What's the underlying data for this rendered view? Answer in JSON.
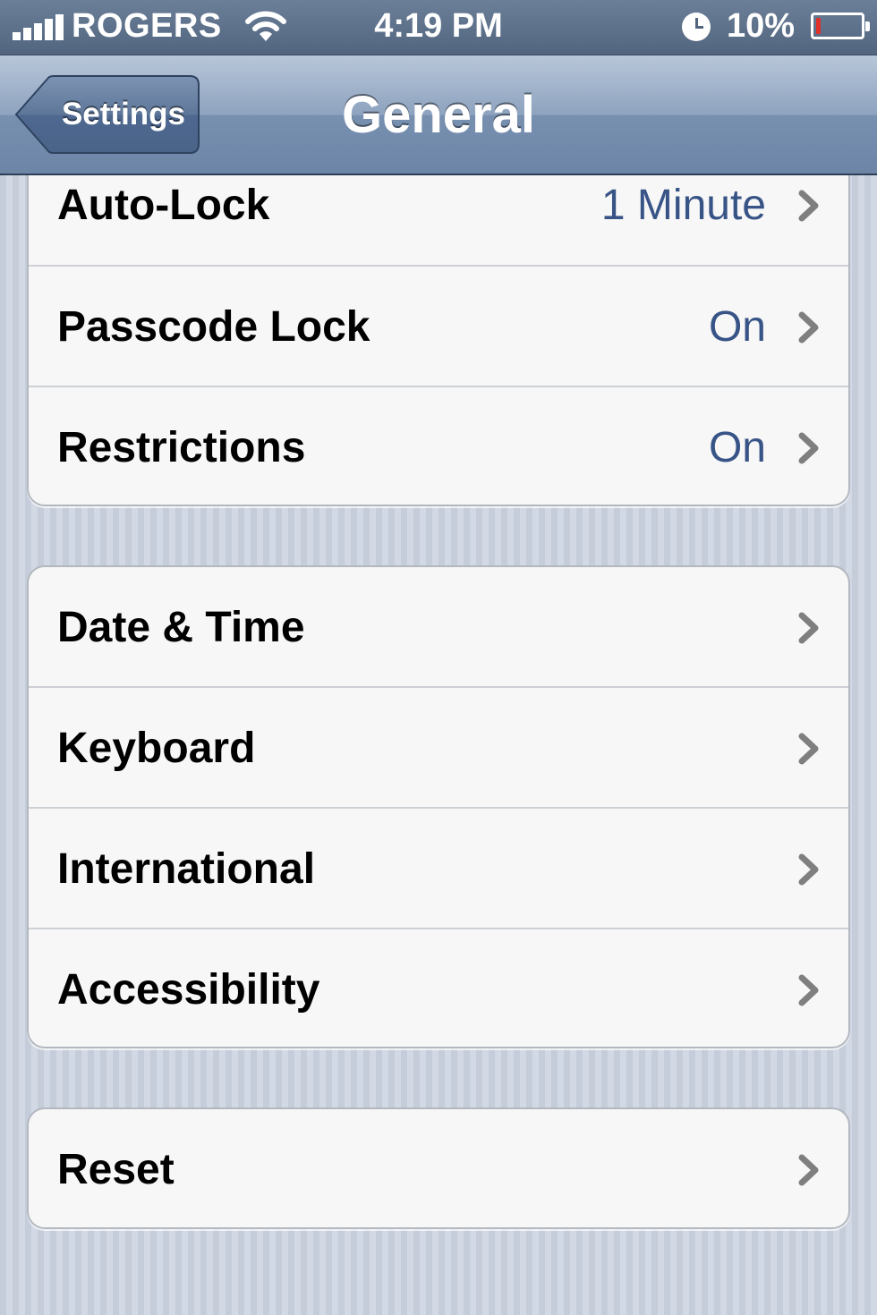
{
  "status_bar": {
    "carrier": "ROGERS",
    "time": "4:19 PM",
    "battery_percent": "10%",
    "battery_level": 0.1,
    "icons": [
      "signal-icon",
      "wifi-icon",
      "alarm-icon",
      "battery-icon"
    ]
  },
  "nav": {
    "back_label": "Settings",
    "title": "General"
  },
  "groups": [
    {
      "rows": [
        {
          "label": "Auto-Lock",
          "value": "1 Minute"
        },
        {
          "label": "Passcode Lock",
          "value": "On"
        },
        {
          "label": "Restrictions",
          "value": "On"
        }
      ]
    },
    {
      "rows": [
        {
          "label": "Date & Time"
        },
        {
          "label": "Keyboard"
        },
        {
          "label": "International"
        },
        {
          "label": "Accessibility"
        }
      ]
    },
    {
      "rows": [
        {
          "label": "Reset"
        }
      ]
    }
  ],
  "colors": {
    "value_text": "#385487",
    "nav_bar": "#7890b0",
    "battery_low": "#e0302a"
  }
}
